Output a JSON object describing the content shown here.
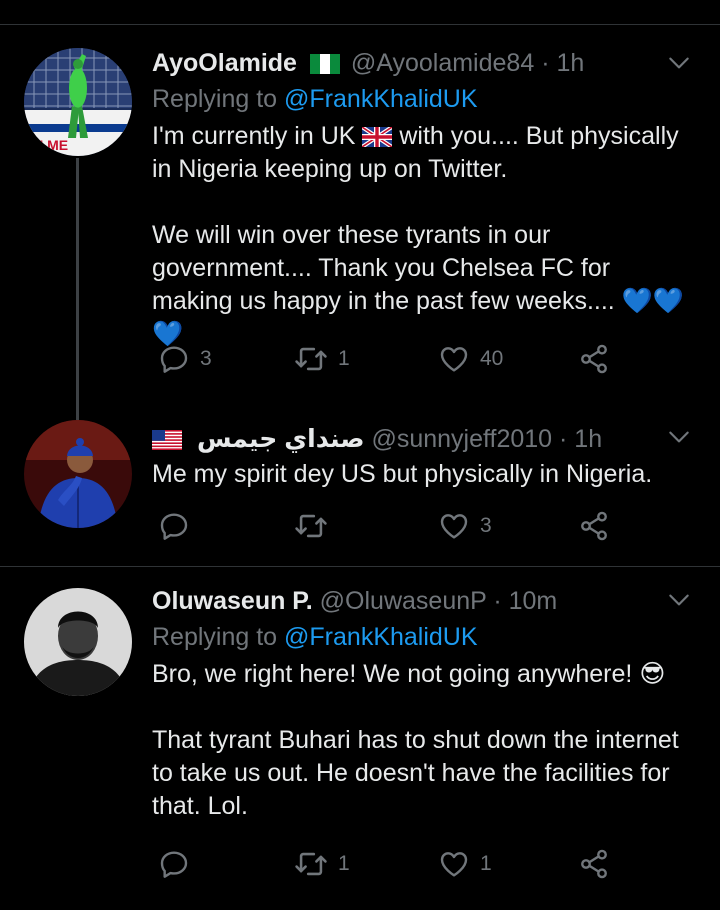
{
  "tweets": [
    {
      "name": "AyoOlamide",
      "flag": "nigeria",
      "handle": "@Ayoolamide84",
      "time": "· 1h",
      "replying_label": "Replying to",
      "replying_handle": "@FrankKhalidUK",
      "line1_pre": "I'm currently in UK",
      "line1_post": "with you.... But physically",
      "line2": "in Nigeria keeping up on Twitter.",
      "para2": "We will win over these tyrants in our government.... Thank you Chelsea FC for making us happy in the past few weeks....",
      "emoji": "💙💙💙",
      "replies": "3",
      "retweets": "1",
      "likes": "40"
    },
    {
      "name": "صنداي جيمس",
      "flag": "usa",
      "handle": "@sunnyjeff2010",
      "time": "· 1h",
      "text": "Me my spirit dey US but physically in Nigeria.",
      "replies": "",
      "retweets": "",
      "likes": "3"
    },
    {
      "name": "Oluwaseun P.",
      "handle": "@OluwaseunP",
      "time": "· 10m",
      "replying_label": "Replying to",
      "replying_handle": "@FrankKhalidUK",
      "para1": "Bro, we right here! We not going anywhere!",
      "emoji": "😎",
      "para2": "That tyrant Buhari has to shut down the internet to take us out. He doesn't have the facilities for that. Lol.",
      "replies": "",
      "retweets": "1",
      "likes": "1"
    }
  ],
  "icons": {
    "reply": "reply-icon",
    "retweet": "retweet-icon",
    "like": "heart-icon",
    "share": "share-icon",
    "more": "chevron-down-icon"
  },
  "colors": {
    "background": "#000000",
    "link": "#1d9bf0",
    "muted": "#71767b",
    "text": "#e7e9ea"
  }
}
